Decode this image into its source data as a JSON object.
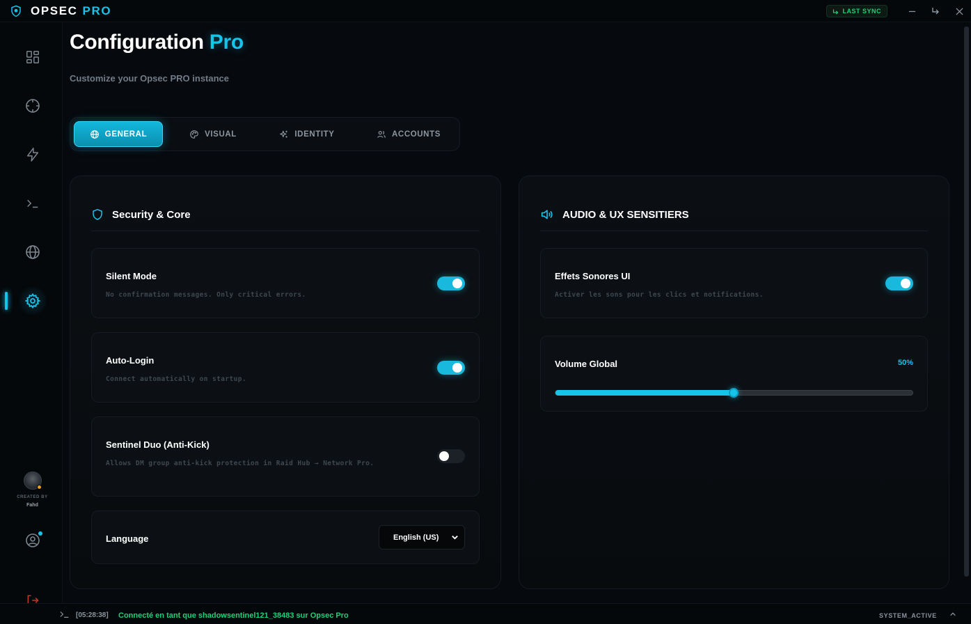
{
  "app": {
    "brand_name": "OPSEC",
    "brand_accent": "PRO"
  },
  "titlebar": {
    "sync_label": "LAST SYNC"
  },
  "sidebar": {
    "items": [
      {
        "name": "dashboard",
        "icon": "grid-icon"
      },
      {
        "name": "target",
        "icon": "crosshair-icon"
      },
      {
        "name": "actions",
        "icon": "lightning-icon"
      },
      {
        "name": "terminal",
        "icon": "terminal-icon"
      },
      {
        "name": "network",
        "icon": "globe-icon"
      },
      {
        "name": "settings",
        "icon": "gear-icon",
        "active": true
      }
    ],
    "creator_label": "CREATED BY",
    "creator_name": "Fahd"
  },
  "page": {
    "title": "Configuration",
    "title_accent": "Pro",
    "subtitle": "Customize your Opsec PRO instance"
  },
  "tabs": [
    {
      "label": "GENERAL",
      "icon": "globe-icon",
      "active": true
    },
    {
      "label": "VISUAL",
      "icon": "palette-icon"
    },
    {
      "label": "IDENTITY",
      "icon": "sparkles-icon"
    },
    {
      "label": "ACCOUNTS",
      "icon": "users-icon"
    }
  ],
  "security": {
    "title": "Security & Core",
    "silent_mode": {
      "title": "Silent Mode",
      "desc": "No confirmation messages. Only critical errors.",
      "enabled": true
    },
    "auto_login": {
      "title": "Auto-Login",
      "desc": "Connect automatically on startup.",
      "enabled": true
    },
    "sentinel_duo": {
      "title": "Sentinel Duo (Anti-Kick)",
      "desc": "Allows DM group anti-kick protection in Raid Hub → Network Pro.",
      "enabled": false
    },
    "language": {
      "title": "Language",
      "value": "English (US)"
    }
  },
  "audio": {
    "title": "AUDIO & UX SENSITIERS",
    "effects": {
      "title": "Effets Sonores UI",
      "desc": "Activer les sons pour les clics et notifications.",
      "enabled": true
    },
    "volume": {
      "title": "Volume Global",
      "value_label": "50%",
      "value": 0.5
    }
  },
  "statusbar": {
    "time": "[05:28:38]",
    "message": "Connecté en tant que shadowsentinel121_38483 sur Opsec Pro",
    "state": "SYSTEM_ACTIVE"
  },
  "colors": {
    "accent": "#16c4ea",
    "success": "#1fd07a",
    "background": "#06090d"
  }
}
